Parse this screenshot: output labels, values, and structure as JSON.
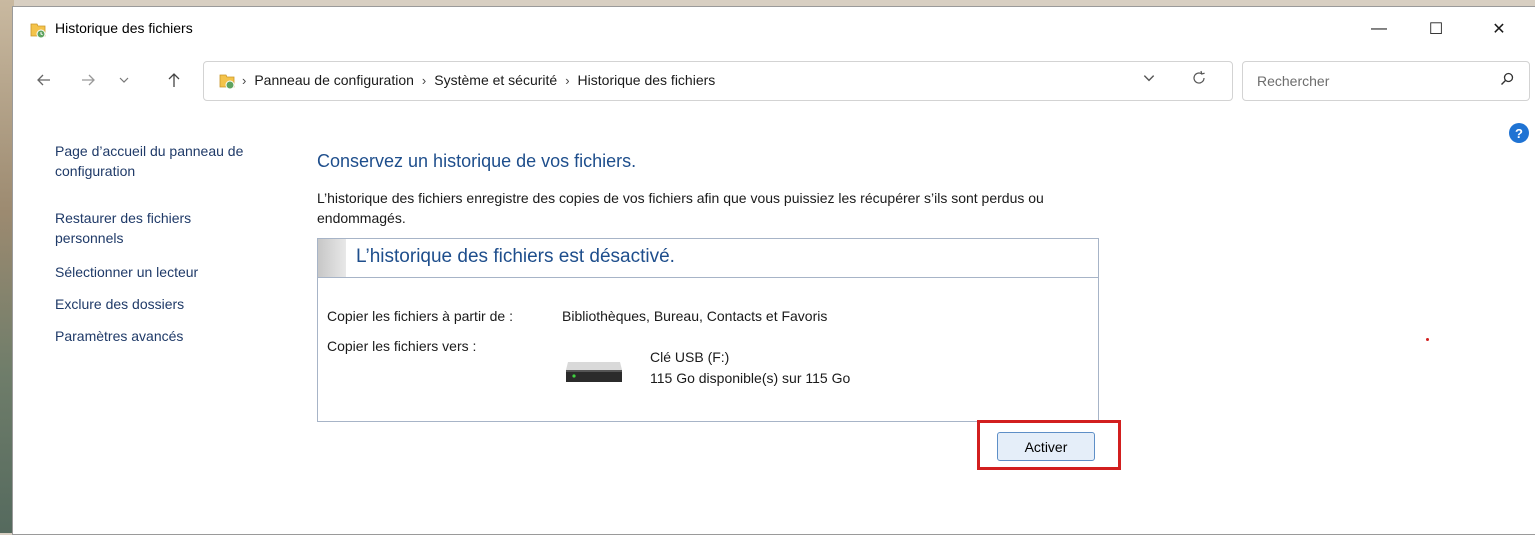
{
  "window": {
    "title": "Historique des fichiers",
    "controls": {
      "minimize": "—",
      "maximize": "☐",
      "close": "✕"
    }
  },
  "nav": {
    "back_icon": "arrow-left-icon",
    "forward_icon": "arrow-right-icon",
    "recent_icon": "chevron-down-icon",
    "up_icon": "arrow-up-icon",
    "breadcrumbs": [
      "Panneau de configuration",
      "Système et sécurité",
      "Historique des fichiers"
    ],
    "search_placeholder": "Rechercher"
  },
  "help_label": "?",
  "sidebar": {
    "items": [
      {
        "label": "Page d’accueil du panneau de configuration"
      },
      {
        "label": "Restaurer des fichiers personnels"
      },
      {
        "label": "Sélectionner un lecteur"
      },
      {
        "label": "Exclure des dossiers"
      },
      {
        "label": "Paramètres avancés"
      }
    ]
  },
  "main": {
    "title": "Conservez un historique de vos fichiers.",
    "description": "L’historique des fichiers enregistre des copies de vos fichiers afin que vous puissiez les récupérer s’ils sont perdus ou endommagés.",
    "status": "L’historique des fichiers est désactivé.",
    "copy_from_label": "Copier les fichiers à partir de :",
    "copy_from_value": "Bibliothèques, Bureau, Contacts et Favoris",
    "copy_to_label": "Copier les fichiers vers :",
    "drive_name": "Clé USB (F:)",
    "drive_space": "115 Go disponible(s) sur 115 Go",
    "activate_button": "Activer"
  },
  "colors": {
    "link": "#1f3a68",
    "heading": "#1e4e8c",
    "highlight": "#d21f1f",
    "button_border": "#5e8fc7",
    "button_bg": "#e5eef9"
  }
}
